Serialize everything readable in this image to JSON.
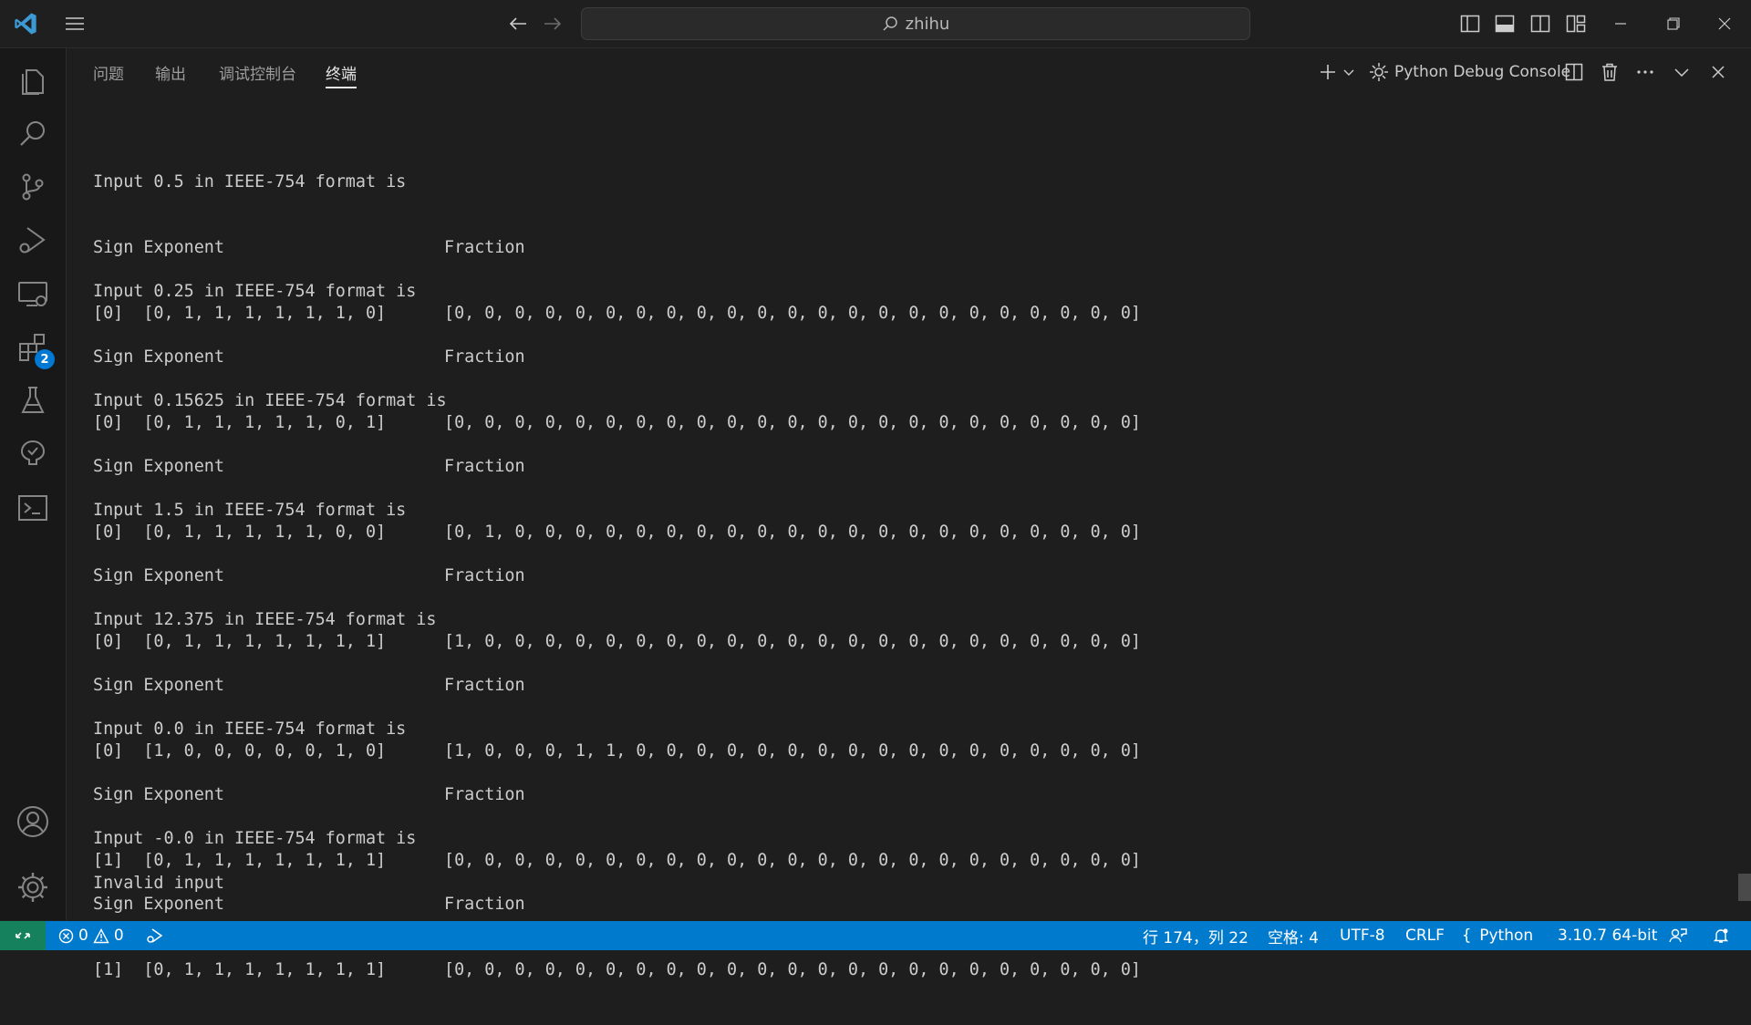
{
  "titlebar": {
    "search_text": "zhihu"
  },
  "activitybar": {
    "extensions_badge": "2"
  },
  "panel": {
    "tabs": [
      {
        "label": "问题"
      },
      {
        "label": "输出"
      },
      {
        "label": "调试控制台"
      },
      {
        "label": "终端"
      }
    ],
    "active_tab": "终端",
    "console_name": "Python Debug Console"
  },
  "terminal": {
    "blocks": [
      {
        "title": "Input 0.5 in IEEE-754 format is",
        "header_a": "Sign Exponent",
        "header_b": "Fraction",
        "values_a": "[0]  [0, 1, 1, 1, 1, 1, 1, 0]",
        "values_b": "[0, 0, 0, 0, 0, 0, 0, 0, 0, 0, 0, 0, 0, 0, 0, 0, 0, 0, 0, 0, 0, 0, 0]"
      },
      {
        "title": "Input 0.25 in IEEE-754 format is",
        "header_a": "Sign Exponent",
        "header_b": "Fraction",
        "values_a": "[0]  [0, 1, 1, 1, 1, 1, 0, 1]",
        "values_b": "[0, 0, 0, 0, 0, 0, 0, 0, 0, 0, 0, 0, 0, 0, 0, 0, 0, 0, 0, 0, 0, 0, 0]"
      },
      {
        "title": "Input 0.15625 in IEEE-754 format is",
        "header_a": "Sign Exponent",
        "header_b": "Fraction",
        "values_a": "[0]  [0, 1, 1, 1, 1, 1, 0, 0]",
        "values_b": "[0, 1, 0, 0, 0, 0, 0, 0, 0, 0, 0, 0, 0, 0, 0, 0, 0, 0, 0, 0, 0, 0, 0]"
      },
      {
        "title": "Input 1.5 in IEEE-754 format is",
        "header_a": "Sign Exponent",
        "header_b": "Fraction",
        "values_a": "[0]  [0, 1, 1, 1, 1, 1, 1, 1]",
        "values_b": "[1, 0, 0, 0, 0, 0, 0, 0, 0, 0, 0, 0, 0, 0, 0, 0, 0, 0, 0, 0, 0, 0, 0]"
      },
      {
        "title": "Input 12.375 in IEEE-754 format is",
        "header_a": "Sign Exponent",
        "header_b": "Fraction",
        "values_a": "[0]  [1, 0, 0, 0, 0, 0, 1, 0]",
        "values_b": "[1, 0, 0, 0, 1, 1, 0, 0, 0, 0, 0, 0, 0, 0, 0, 0, 0, 0, 0, 0, 0, 0, 0]"
      },
      {
        "title": "Input 0.0 in IEEE-754 format is",
        "header_a": "Sign Exponent",
        "header_b": "Fraction",
        "values_a": "[1]  [0, 1, 1, 1, 1, 1, 1, 1]",
        "values_b": "[0, 0, 0, 0, 0, 0, 0, 0, 0, 0, 0, 0, 0, 0, 0, 0, 0, 0, 0, 0, 0, 0, 0]"
      },
      {
        "title": "Input -0.0 in IEEE-754 format is",
        "header_a": "Sign Exponent",
        "header_b": "Fraction",
        "values_a": "[1]  [0, 1, 1, 1, 1, 1, 1, 1]",
        "values_b": "[0, 0, 0, 0, 0, 0, 0, 0, 0, 0, 0, 0, 0, 0, 0, 0, 0, 0, 0, 0, 0, 0, 0]"
      }
    ],
    "final_line": "Invalid input"
  },
  "statusbar": {
    "errors": "0",
    "warnings": "0",
    "cursor_position": "行 174，列 22",
    "indentation": "空格: 4",
    "encoding": "UTF-8",
    "eol": "CRLF",
    "language": "Python",
    "interpreter": "3.10.7 64-bit"
  },
  "colors": {
    "statusbar_bg": "#007acc",
    "remote_bg": "#16825d",
    "badge_bg": "#0078d4",
    "vscode_logo": "#3c99d4"
  }
}
